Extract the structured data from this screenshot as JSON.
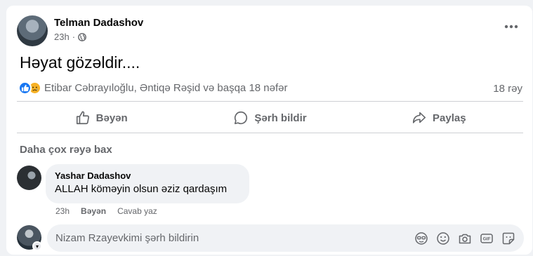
{
  "post": {
    "author": "Telman Dadashov",
    "time": "23h",
    "dot": "·",
    "text": "Həyat gözəldir....",
    "reactions_text": "Etibar Cəbrayıloğlu, Əntiqə Rəşid və başqa 18 nəfər",
    "comment_count": "18 rəy",
    "icons": {
      "more": "more-icon",
      "privacy": "globe-icon",
      "like": "like-reaction-icon",
      "sad": "sad-reaction-icon"
    }
  },
  "actions": {
    "like": "Bəyən",
    "comment": "Şərh bildir",
    "share": "Paylaş"
  },
  "more_comments": "Daha çox rəyə bax",
  "comment": {
    "author": "Yashar Dadashov",
    "text": "ALLAH köməyin olsun əziz qardaşım",
    "time": "23h",
    "like": "Bəyən",
    "reply": "Cavab yaz"
  },
  "composer": {
    "placeholder": "Nizam Rzayevkimi şərh bildirin",
    "icons": [
      "avatar-sticker-icon",
      "emoji-icon",
      "camera-icon",
      "gif-icon",
      "sticker-icon"
    ]
  },
  "colors": {
    "accent": "#1877f2",
    "muted": "#65676b",
    "background": "#f0f2f5"
  }
}
